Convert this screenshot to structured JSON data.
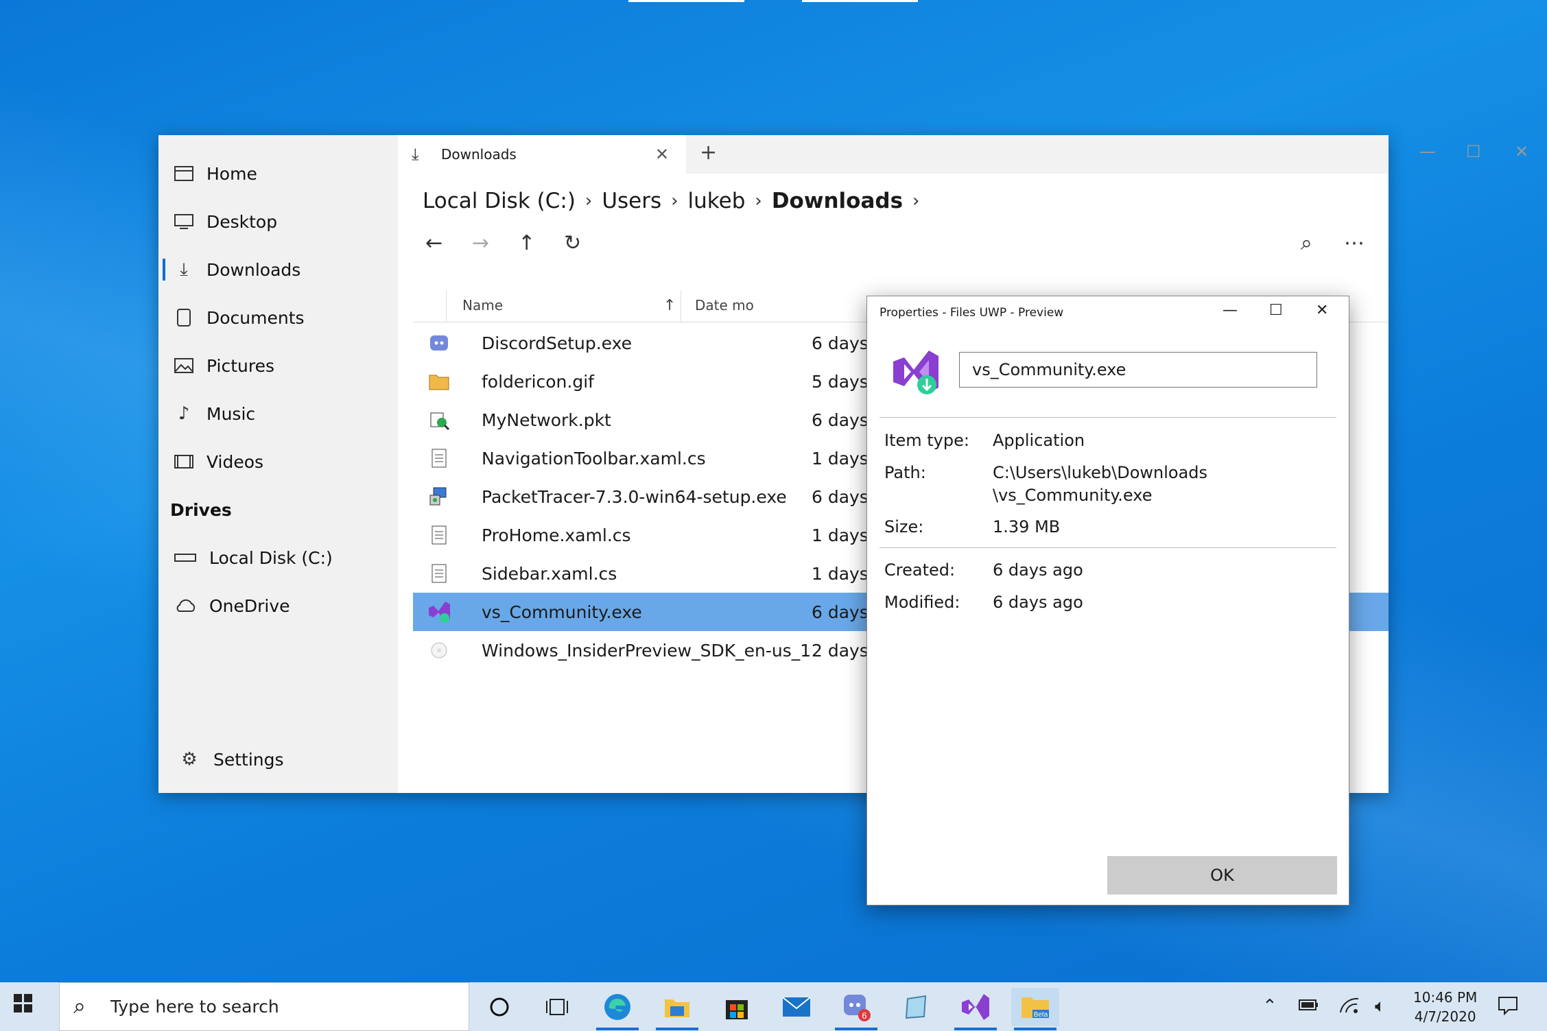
{
  "window": {
    "tab_title": "Downloads",
    "tab_icon": "download-icon",
    "add_tab": "+"
  },
  "sidebar": {
    "items": [
      {
        "label": "Home",
        "icon": "home-icon"
      },
      {
        "label": "Desktop",
        "icon": "desktop-icon"
      },
      {
        "label": "Downloads",
        "icon": "download-icon",
        "selected": true
      },
      {
        "label": "Documents",
        "icon": "document-icon"
      },
      {
        "label": "Pictures",
        "icon": "picture-icon"
      },
      {
        "label": "Music",
        "icon": "music-icon"
      },
      {
        "label": "Videos",
        "icon": "video-icon"
      }
    ],
    "drives_header": "Drives",
    "drives": [
      {
        "label": "Local Disk (C:)",
        "icon": "drive-icon"
      },
      {
        "label": "OneDrive",
        "icon": "cloud-icon"
      }
    ],
    "settings_label": "Settings"
  },
  "breadcrumb": [
    "Local Disk (C:)",
    "Users",
    "lukeb",
    "Downloads"
  ],
  "columns": {
    "name": "Name",
    "date": "Date mo"
  },
  "files": [
    {
      "name": "DiscordSetup.exe",
      "date": "6 days",
      "icon": "discord-icon"
    },
    {
      "name": "foldericon.gif",
      "date": "5 days",
      "icon": "folder-image-icon"
    },
    {
      "name": "MyNetwork.pkt",
      "date": "6 days",
      "icon": "packet-file-icon"
    },
    {
      "name": "NavigationToolbar.xaml.cs",
      "date": "1 days",
      "icon": "csharp-file-icon"
    },
    {
      "name": "PacketTracer-7.3.0-win64-setup.exe",
      "date": "6 days",
      "icon": "installer-icon"
    },
    {
      "name": "ProHome.xaml.cs",
      "date": "1 days",
      "icon": "csharp-file-icon"
    },
    {
      "name": "Sidebar.xaml.cs",
      "date": "1 days",
      "icon": "csharp-file-icon"
    },
    {
      "name": "vs_Community.exe",
      "date": "6 days",
      "icon": "visual-studio-icon",
      "selected": true
    },
    {
      "name": "Windows_InsiderPreview_SDK_en-us_1",
      "date": "2 days",
      "icon": "disc-image-icon"
    }
  ],
  "properties": {
    "title": "Properties - Files UWP - Preview",
    "file_name": "vs_Community.exe",
    "item_type_label": "Item type:",
    "item_type": "Application",
    "path_label": "Path:",
    "path_line1": "C:\\Users\\lukeb\\Downloads",
    "path_line2": "\\vs_Community.exe",
    "size_label": "Size:",
    "size": "1.39 MB",
    "created_label": "Created:",
    "created": "6 days ago",
    "modified_label": "Modified:",
    "modified": "6 days ago",
    "ok_label": "OK"
  },
  "taskbar": {
    "search_placeholder": "Type here to search",
    "mail_badge": "6",
    "time": "10:46 PM",
    "date": "4/7/2020"
  },
  "colors": {
    "accent": "#0a6fd6",
    "selection": "#68a8e8",
    "desktop": "#0c7ddb"
  }
}
